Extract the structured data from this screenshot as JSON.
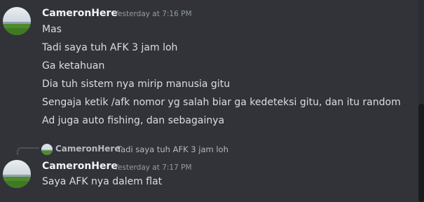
{
  "messages": [
    {
      "author": "CameronHere",
      "timestamp": "Yesterday at 7:16 PM",
      "lines": [
        "Mas",
        "Tadi saya tuh AFK 3 jam loh",
        "Ga ketahuan",
        "Dia tuh sistem nya mirip manusia gitu",
        "Sengaja ketik /afk nomor yg salah biar ga kedeteksi gitu, dan itu random",
        "Ad juga auto fishing, dan sebagainya"
      ]
    },
    {
      "reply": {
        "author": "CameronHere",
        "text": "Tadi saya tuh AFK 3 jam loh"
      },
      "author": "CameronHere",
      "timestamp": "Yesterday at 7:17 PM",
      "lines": [
        "Saya AFK nya dalem flat"
      ]
    }
  ],
  "colors": {
    "background": "#313338",
    "author": "#f2f3f5",
    "text": "#dbdee1",
    "timestamp": "#949ba4"
  },
  "icons": {
    "avatar": "landscape-avatar-icon"
  }
}
